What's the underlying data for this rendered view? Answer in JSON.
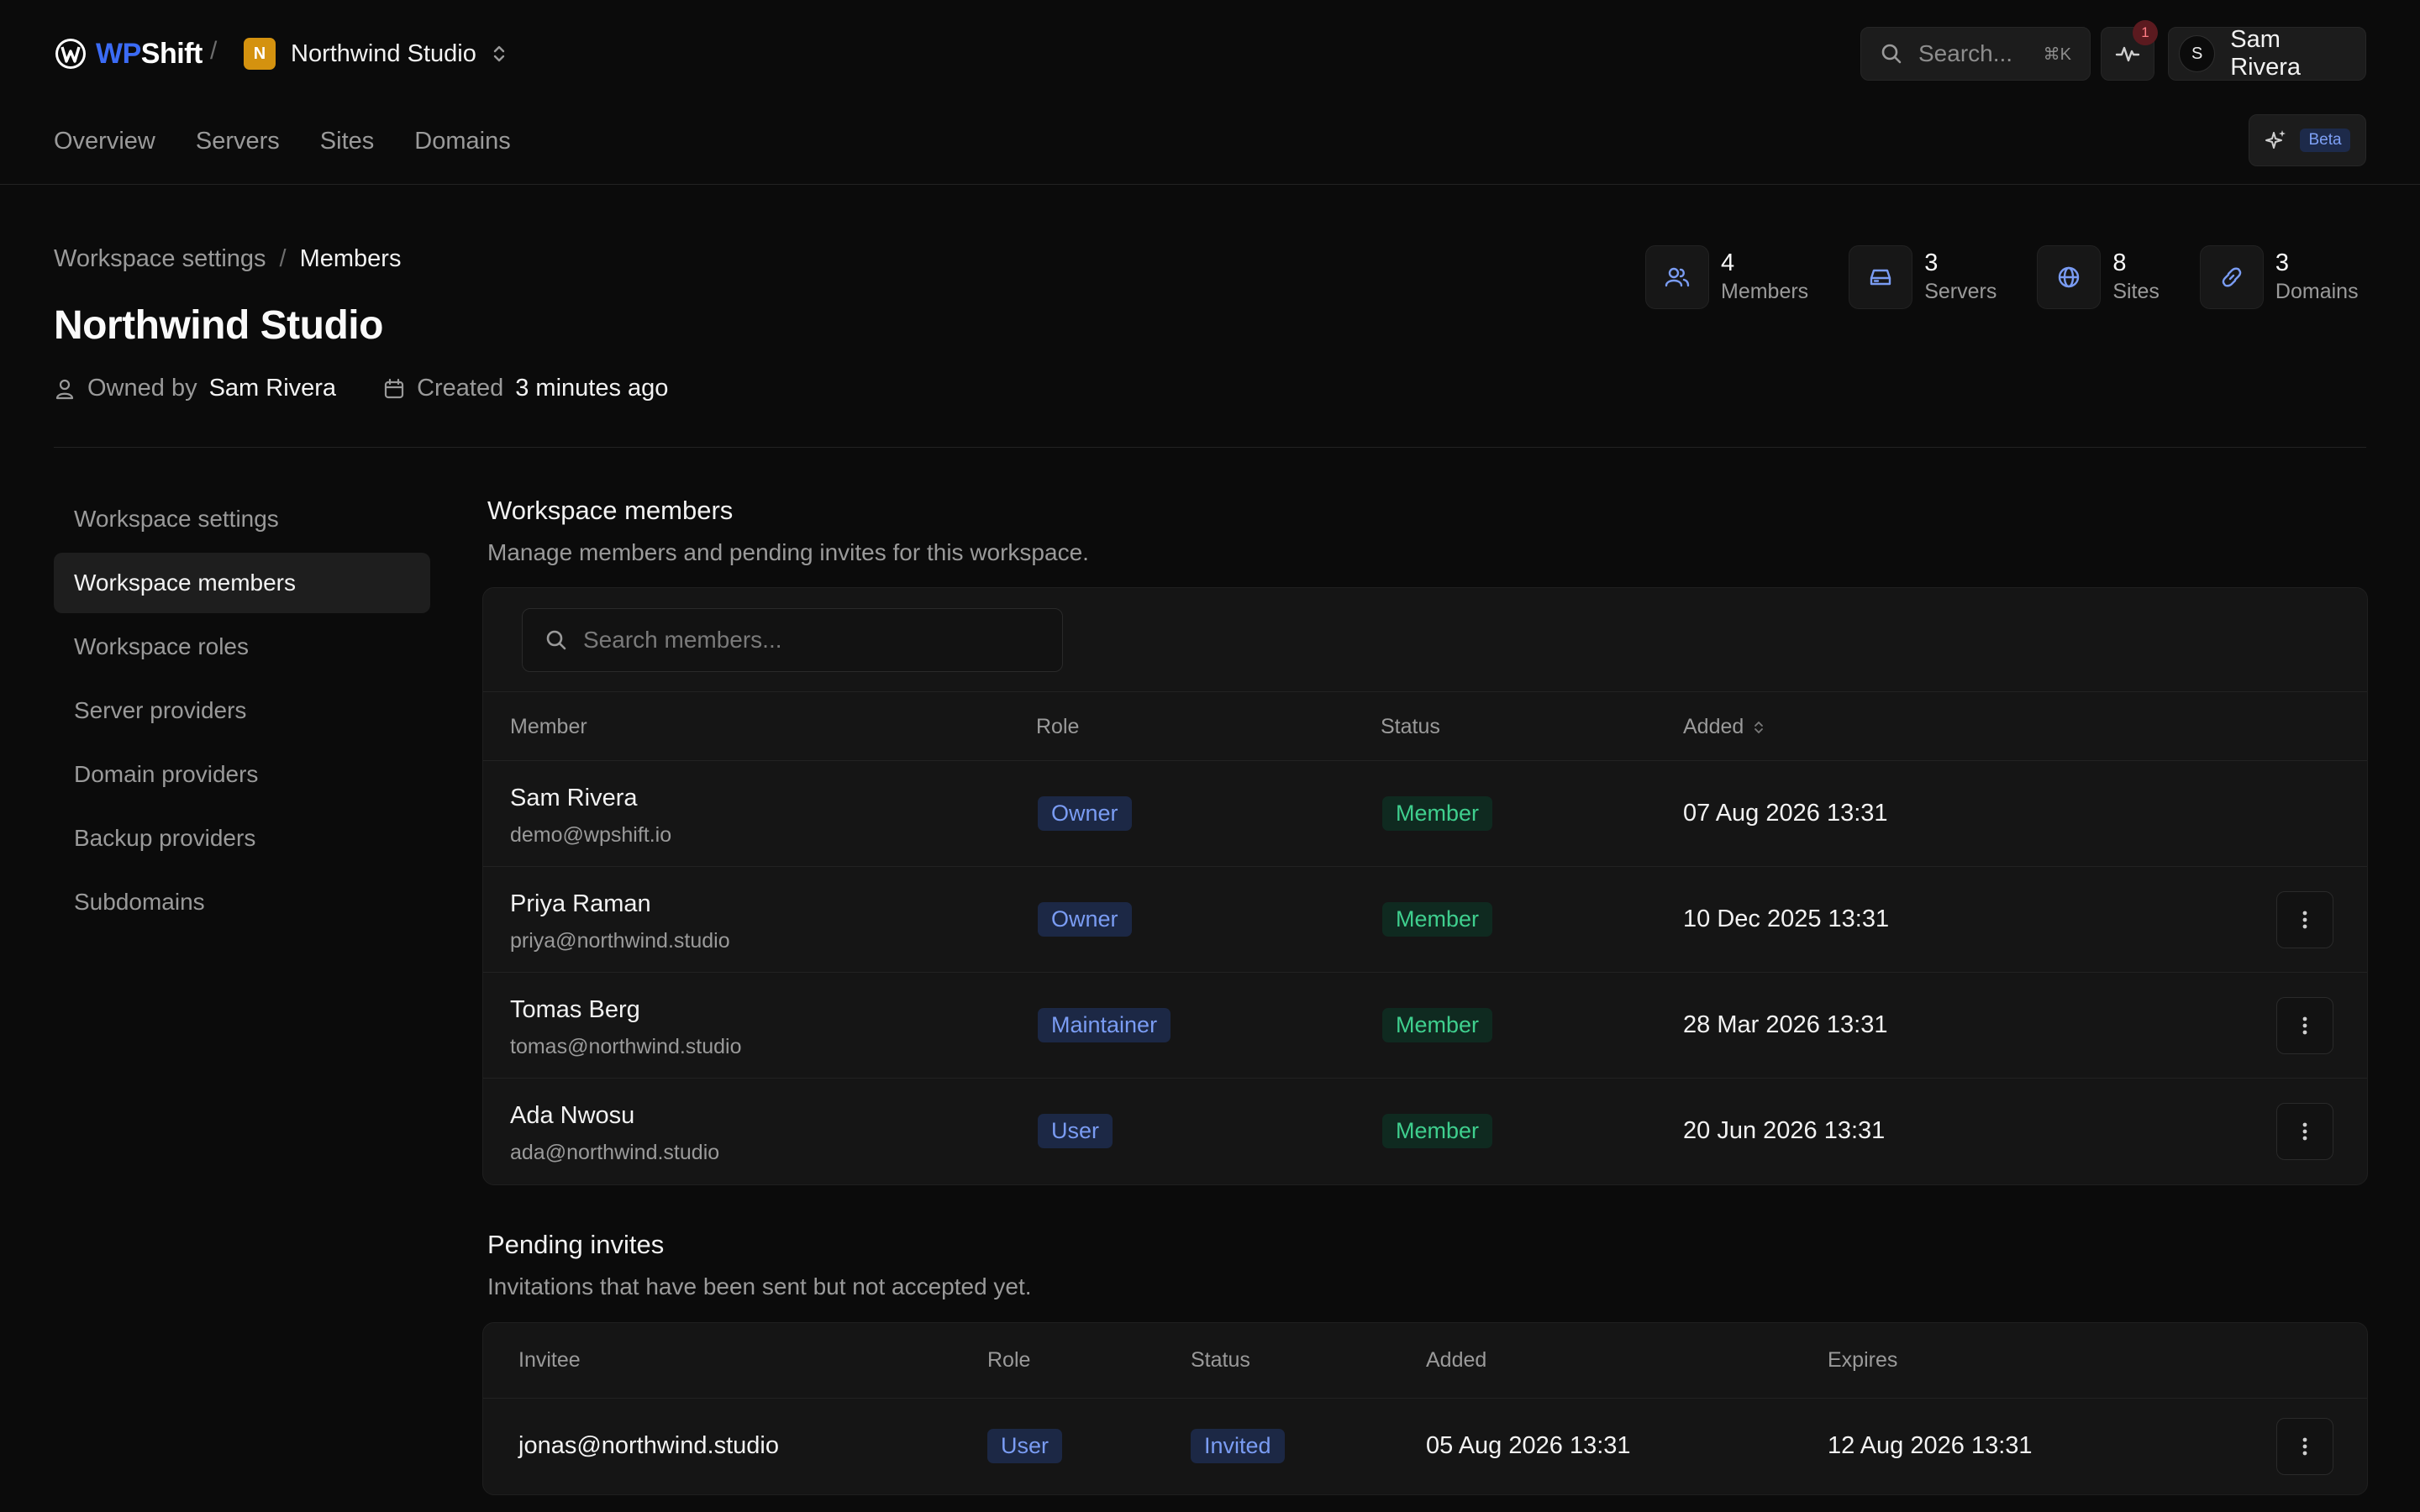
{
  "brand": {
    "logo_prefix": "WP",
    "logo_suffix": "Shift"
  },
  "workspace_switcher": {
    "badge": "N",
    "name": "Northwind Studio"
  },
  "topbar": {
    "search_placeholder": "Search...",
    "search_shortcut": "⌘K",
    "notification_count": "1",
    "user_initial": "S",
    "user_name": "Sam Rivera"
  },
  "nav": {
    "items": [
      "Overview",
      "Servers",
      "Sites",
      "Domains"
    ],
    "ai_badge": "Beta"
  },
  "breadcrumb": {
    "parent": "Workspace settings",
    "current": "Members"
  },
  "header": {
    "title": "Northwind Studio",
    "owned_by_label": "Owned by",
    "owner": "Sam Rivera",
    "created_label": "Created",
    "created_value": "3 minutes ago"
  },
  "stats": [
    {
      "value": "4",
      "label": "Members",
      "icon": "users-icon"
    },
    {
      "value": "3",
      "label": "Servers",
      "icon": "server-icon"
    },
    {
      "value": "8",
      "label": "Sites",
      "icon": "globe-icon"
    },
    {
      "value": "3",
      "label": "Domains",
      "icon": "link-icon"
    }
  ],
  "sidebar": {
    "items": [
      "Workspace settings",
      "Workspace members",
      "Workspace roles",
      "Server providers",
      "Domain providers",
      "Backup providers",
      "Subdomains"
    ],
    "active": "Workspace members"
  },
  "members": {
    "title": "Workspace members",
    "subtitle": "Manage members and pending invites for this workspace.",
    "search_placeholder": "Search members...",
    "columns": {
      "member": "Member",
      "role": "Role",
      "status": "Status",
      "added": "Added"
    },
    "rows": [
      {
        "name": "Sam Rivera",
        "email": "demo@wpshift.io",
        "role": "Owner",
        "status": "Member",
        "added": "07 Aug 2026 13:31"
      },
      {
        "name": "Priya Raman",
        "email": "priya@northwind.studio",
        "role": "Owner",
        "status": "Member",
        "added": "10 Dec 2025 13:31"
      },
      {
        "name": "Tomas Berg",
        "email": "tomas@northwind.studio",
        "role": "Maintainer",
        "status": "Member",
        "added": "28 Mar 2026 13:31"
      },
      {
        "name": "Ada Nwosu",
        "email": "ada@northwind.studio",
        "role": "User",
        "status": "Member",
        "added": "20 Jun 2026 13:31"
      }
    ]
  },
  "invites": {
    "title": "Pending invites",
    "subtitle": "Invitations that have been sent but not accepted yet.",
    "columns": {
      "invitee": "Invitee",
      "role": "Role",
      "status": "Status",
      "added": "Added",
      "expires": "Expires"
    },
    "rows": [
      {
        "invitee": "jonas@northwind.studio",
        "role": "User",
        "status": "Invited",
        "added": "05 Aug 2026 13:31",
        "expires": "12 Aug 2026 13:31"
      }
    ]
  }
}
